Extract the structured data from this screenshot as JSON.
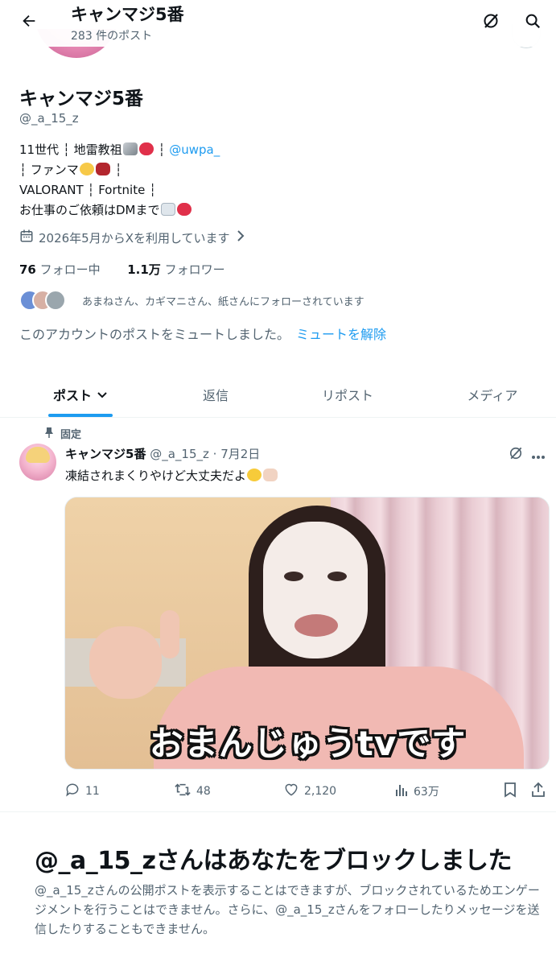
{
  "header": {
    "back_icon": "arrow-left-icon",
    "title": "キャンマジ5番",
    "post_count": "283 件のポスト",
    "grok_icon": "grok-icon",
    "search_icon": "search-icon"
  },
  "profile": {
    "name": "キャンマジ5番",
    "handle": "@_a_15_z",
    "bio": {
      "line1_text": "11世代 ┆ 地雷教祖",
      "line1_sep": " ┆ ",
      "line1_mention": "@uwpa_",
      "line2_a": "┆ ファンマ",
      "line2_b": " ┆",
      "line3": "VALORANT ┆ Fortnite ┆",
      "line4": "お仕事のご依頼はDMまで"
    },
    "joined": "2026年5月からXを利用しています",
    "following_count": "76",
    "following_label": "フォロー中",
    "followers_count": "1.1万",
    "followers_label": "フォロワー",
    "followed_by": "あまねさん、カギマニさん、紙さんにフォローされています",
    "muted_text": "このアカウントのポストをミュートしました。",
    "unmute_label": "ミュートを解除"
  },
  "tabs": [
    {
      "label": "ポスト",
      "active": true
    },
    {
      "label": "返信",
      "active": false
    },
    {
      "label": "リポスト",
      "active": false
    },
    {
      "label": "メディア",
      "active": false
    }
  ],
  "post": {
    "pinned_label": "固定",
    "author_name": "キャンマジ5番",
    "meta": "@_a_15_z · 7月2日",
    "text": "凍結されまくりやけど大丈夫だよ",
    "image_caption": "おまんじゅうtvです",
    "replies": "11",
    "reposts": "48",
    "likes": "2,120",
    "views": "63万"
  },
  "block_notice": {
    "title": "@_a_15_zさんはあなたをブロックしました",
    "body": "@_a_15_zさんの公開ポストを表示することはできますが、ブロックされているためエンゲージメントを行うことはできません。さらに、@_a_15_zさんをフォローしたりメッセージを送信したりすることもできません。"
  },
  "colors": {
    "accent": "#1d9bf0",
    "text_primary": "#0f1419",
    "text_secondary": "#536471"
  }
}
